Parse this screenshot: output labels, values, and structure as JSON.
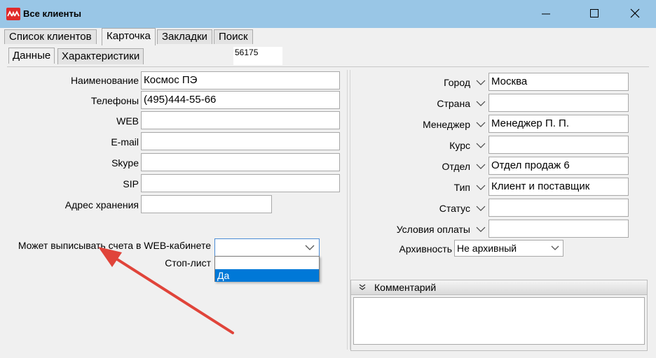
{
  "window": {
    "title": "Все клиенты"
  },
  "main_tabs": [
    {
      "label": "Список клиентов"
    },
    {
      "label": "Карточка"
    },
    {
      "label": "Закладки"
    },
    {
      "label": "Поиск"
    }
  ],
  "sub_tabs": [
    {
      "label": "Данные"
    },
    {
      "label": "Характеристики"
    }
  ],
  "record_id": "56175",
  "left_fields": {
    "name": {
      "label": "Наименование",
      "value": "Космос ПЭ"
    },
    "phones": {
      "label": "Телефоны",
      "value": "(495)444-55-66"
    },
    "web": {
      "label": "WEB",
      "value": ""
    },
    "email": {
      "label": "E-mail",
      "value": ""
    },
    "skype": {
      "label": "Skype",
      "value": ""
    },
    "sip": {
      "label": "SIP",
      "value": ""
    },
    "storage_address": {
      "label": "Адрес хранения",
      "value": ""
    }
  },
  "web_invoice": {
    "label": "Может выписывать счета в WEB-кабинете",
    "value": "",
    "options": [
      "",
      "Да"
    ]
  },
  "stop_list": {
    "label": "Стоп-лист"
  },
  "right_fields": {
    "city": {
      "label": "Город",
      "value": "Москва"
    },
    "country": {
      "label": "Страна",
      "value": ""
    },
    "manager": {
      "label": "Менеджер",
      "value": "Менеджер П. П."
    },
    "rate": {
      "label": "Курс",
      "value": ""
    },
    "department": {
      "label": "Отдел",
      "value": "Отдел продаж 6"
    },
    "type": {
      "label": "Тип",
      "value": "Клиент и поставщик"
    },
    "status": {
      "label": "Статус",
      "value": ""
    },
    "payment_terms": {
      "label": "Условия оплаты",
      "value": ""
    }
  },
  "archive": {
    "label": "Архивность",
    "value": "Не архивный"
  },
  "comment": {
    "header": "Комментарий",
    "value": ""
  },
  "annotation": {
    "arrow_color": "#e0443a"
  },
  "colors": {
    "titlebar": "#99c6e6",
    "selection": "#0078d7",
    "app_icon": "#e02a2a"
  }
}
